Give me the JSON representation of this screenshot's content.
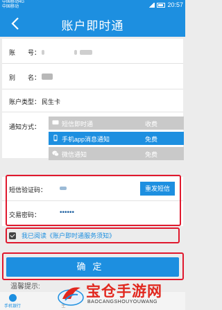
{
  "status_bar": {
    "carrier_1": "中国移动4G",
    "carrier_2": "中国移动",
    "time": "20:57"
  },
  "header": {
    "title": "账户即时通"
  },
  "account": {
    "account_label": "账　　号：",
    "name_label": "别　　名：",
    "type_label": "账户类型：",
    "type_value": "民生卡",
    "notify_label": "通知方式："
  },
  "notify_options": [
    {
      "name": "短信即时通",
      "fee": "收费",
      "selected": false,
      "icon": "sms-icon"
    },
    {
      "name": "手机app消息通知",
      "fee": "免费",
      "selected": true,
      "icon": "phone-icon"
    },
    {
      "name": "微信通知",
      "fee": "免费",
      "selected": false,
      "icon": "wechat-icon"
    }
  ],
  "verify": {
    "sms_code_label": "短信验证码：",
    "resend_label": "重发短信",
    "password_label": "交易密码：",
    "password_value": "••••••"
  },
  "agreement": {
    "text": "我已阅读《账户即时通服务须知》"
  },
  "confirm_label": "确定",
  "tips_label": "温馨提示:",
  "tabs": [
    {
      "label": "手机银行",
      "active": true
    },
    {
      "label": "生",
      "active": false
    }
  ],
  "watermark": {
    "cn": "宝仓手游网",
    "en": "BAOCANGSHOUYOUWANG"
  },
  "colors": {
    "accent": "#1d8fe0",
    "highlight_border": "#e0182d",
    "disabled_option": "#c9c9c9"
  }
}
